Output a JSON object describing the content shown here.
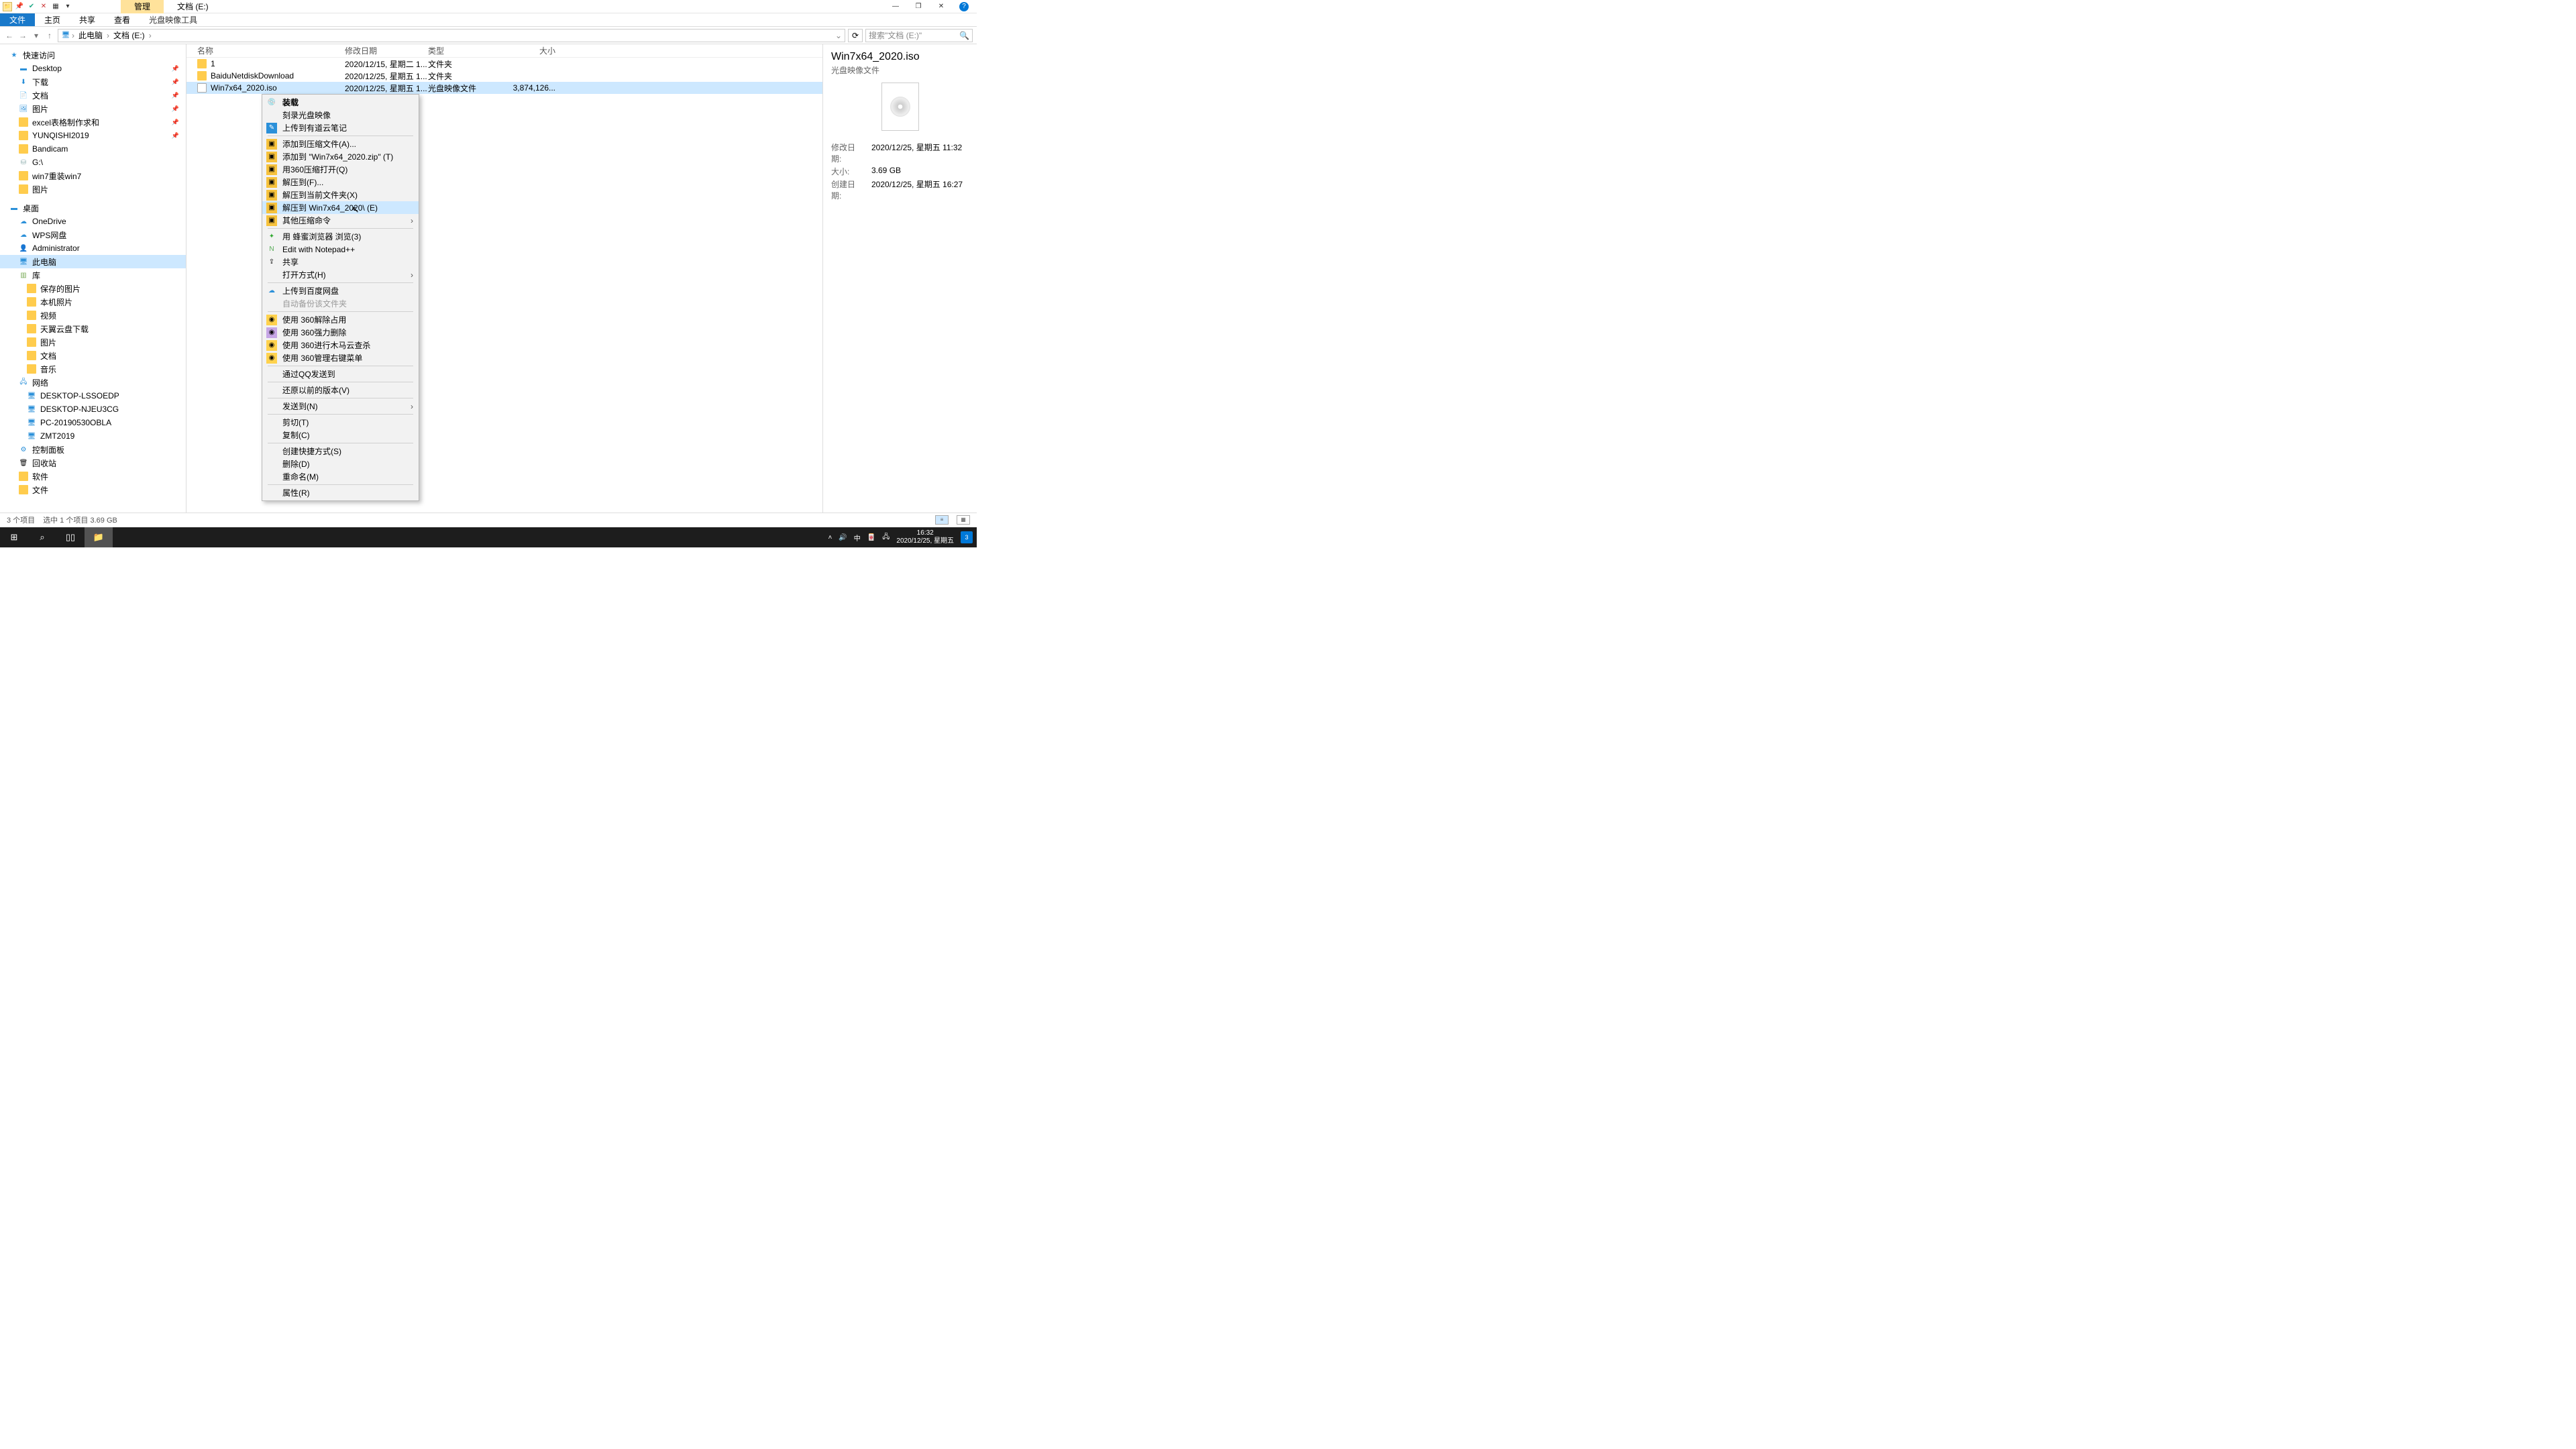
{
  "window": {
    "context_tab": "管理",
    "title_tab": "文档 (E:)"
  },
  "ribbon": {
    "file": "文件",
    "home": "主页",
    "share": "共享",
    "view": "查看",
    "disc_tools": "光盘映像工具"
  },
  "addr": {
    "root": "此电脑",
    "loc": "文档 (E:)",
    "search_placeholder": "搜索\"文档 (E:)\""
  },
  "tree": {
    "quick": "快速访问",
    "desktop_q": "Desktop",
    "downloads_q": "下载",
    "docs_q": "文档",
    "pics_q": "图片",
    "excel": "excel表格制作求和",
    "yunqishi": "YUNQISHI2019",
    "bandicam": "Bandicam",
    "gdrive": "G:\\",
    "win7": "win7重装win7",
    "pics2": "图片",
    "desk_section": "桌面",
    "onedrive": "OneDrive",
    "wps": "WPS网盘",
    "admin": "Administrator",
    "thispc": "此电脑",
    "lib": "库",
    "saved": "保存的图片",
    "localphoto": "本机照片",
    "video": "视频",
    "tianyi": "天翼云盘下载",
    "pics3": "图片",
    "docs3": "文档",
    "music": "音乐",
    "network": "网络",
    "pc1": "DESKTOP-LSSOEDP",
    "pc2": "DESKTOP-NJEU3CG",
    "pc3": "PC-20190530OBLA",
    "pc4": "ZMT2019",
    "cpanel": "控制面板",
    "recycle": "回收站",
    "soft": "软件",
    "files": "文件"
  },
  "cols": {
    "name": "名称",
    "date": "修改日期",
    "type": "类型",
    "size": "大小"
  },
  "rows": [
    {
      "name": "1",
      "date": "2020/12/15, 星期二 1...",
      "type": "文件夹",
      "size": ""
    },
    {
      "name": "BaiduNetdiskDownload",
      "date": "2020/12/25, 星期五 1...",
      "type": "文件夹",
      "size": ""
    },
    {
      "name": "Win7x64_2020.iso",
      "date": "2020/12/25, 星期五 1...",
      "type": "光盘映像文件",
      "size": "3,874,126..."
    }
  ],
  "context": {
    "mount": "装载",
    "burn": "刻录光盘映像",
    "youdao": "上传到有道云笔记",
    "add_archive": "添加到压缩文件(A)...",
    "add_zip": "添加到 \"Win7x64_2020.zip\" (T)",
    "open360": "用360压缩打开(Q)",
    "extract_to": "解压到(F)...",
    "extract_here": "解压到当前文件夹(X)",
    "extract_named": "解压到 Win7x64_2020\\ (E)",
    "other_zip": "其他压缩命令",
    "fengmi": "用 蜂蜜浏览器 浏览(3)",
    "npp": "Edit with Notepad++",
    "share": "共享",
    "openwith": "打开方式(H)",
    "baidu": "上传到百度网盘",
    "autobak": "自动备份该文件夹",
    "unlock360": "使用 360解除占用",
    "force360": "使用 360强力删除",
    "trojan360": "使用 360进行木马云查杀",
    "manage360": "使用 360管理右键菜单",
    "qqsend": "通过QQ发送到",
    "restore": "还原以前的版本(V)",
    "sendto": "发送到(N)",
    "cut": "剪切(T)",
    "copy": "复制(C)",
    "shortcut": "创建快捷方式(S)",
    "delete": "删除(D)",
    "rename": "重命名(M)",
    "props": "属性(R)"
  },
  "preview": {
    "title": "Win7x64_2020.iso",
    "subtitle": "光盘映像文件",
    "mod_k": "修改日期:",
    "mod_v": "2020/12/25, 星期五 11:32",
    "size_k": "大小:",
    "size_v": "3.69 GB",
    "create_k": "创建日期:",
    "create_v": "2020/12/25, 星期五 16:27"
  },
  "status": {
    "count": "3 个项目",
    "sel": "选中 1 个项目  3.69 GB"
  },
  "taskbar": {
    "time": "16:32",
    "date": "2020/12/25, 星期五",
    "ime": "中",
    "notif": "3"
  }
}
